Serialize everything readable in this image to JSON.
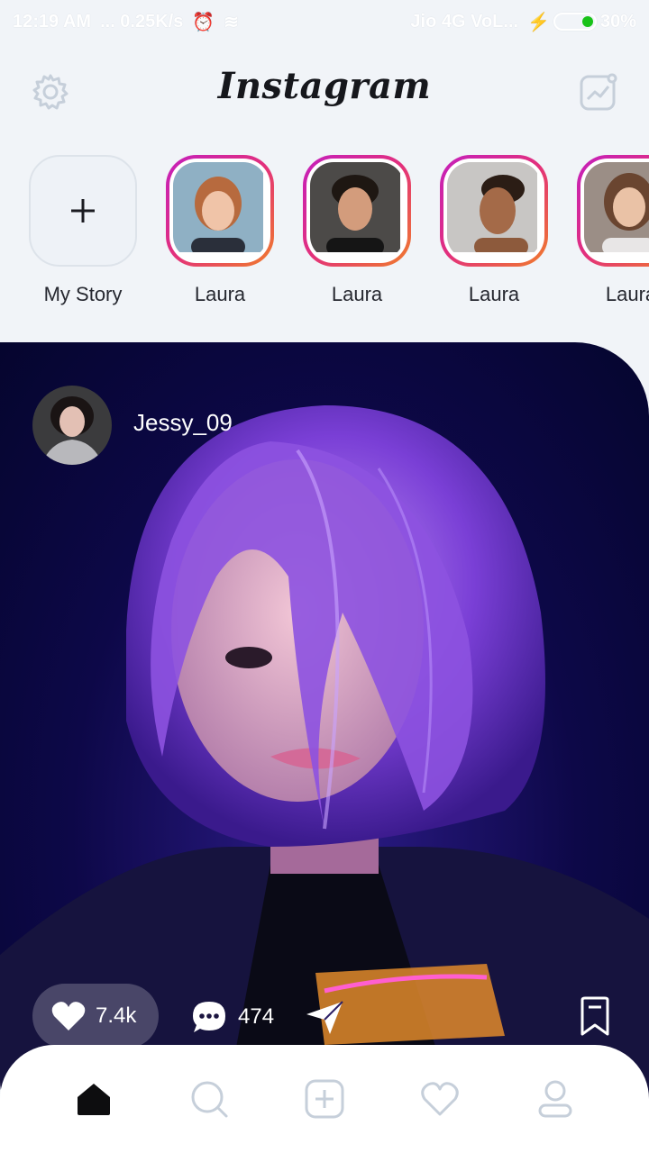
{
  "status_bar": {
    "time": "12:19 AM",
    "net_speed": "... 0.25K/s",
    "carrier": "Jio 4G VoL...",
    "battery": "30%"
  },
  "header": {
    "logo": "Instagram",
    "settings_icon": "gear-icon",
    "activity_icon": "trend-chart-icon"
  },
  "stories": [
    {
      "name": "My Story",
      "type": "add"
    },
    {
      "name": "Laura"
    },
    {
      "name": "Laura"
    },
    {
      "name": "Laura"
    },
    {
      "name": "Laura"
    }
  ],
  "post": {
    "author": "Jessy_09",
    "likes": "7.4k",
    "comments": "474"
  },
  "tabbar": {
    "items": [
      "home-icon",
      "search-icon",
      "add-post-icon",
      "activity-heart-icon",
      "profile-icon"
    ],
    "active": "home-icon"
  },
  "colors": {
    "story_ring": [
      "#c41fbd",
      "#e3307b",
      "#f07d2a"
    ],
    "post_bg": "#0d0848"
  }
}
